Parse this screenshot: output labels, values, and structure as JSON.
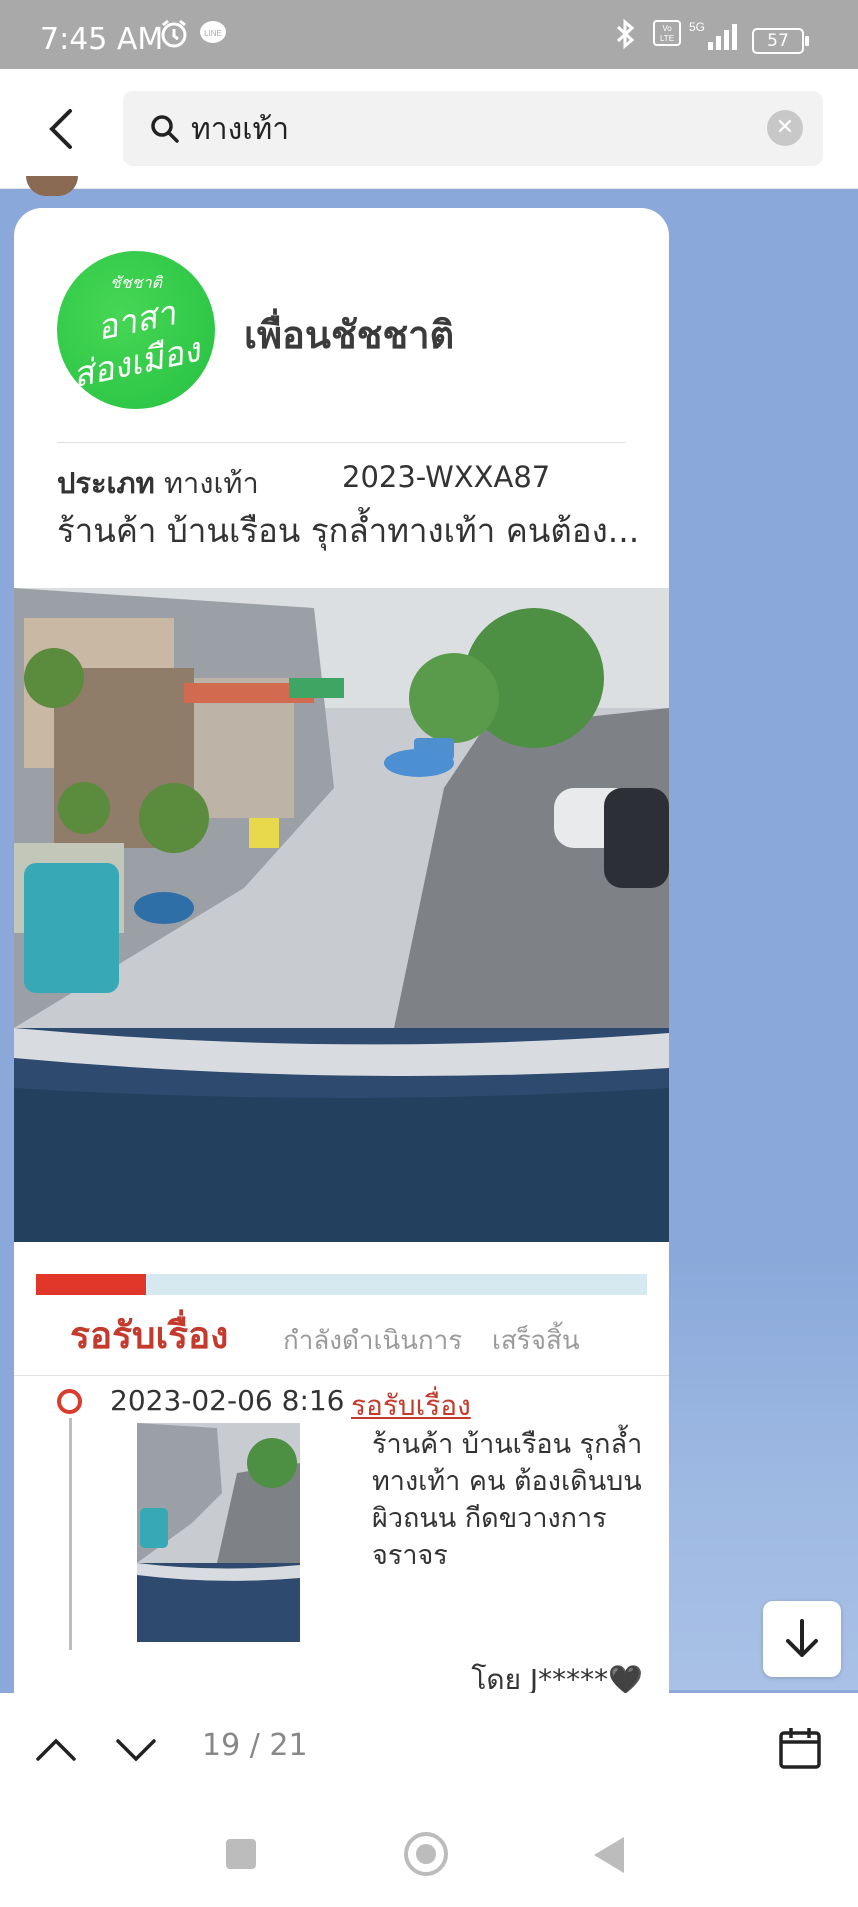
{
  "status_bar": {
    "time": "7:45 AM",
    "icons": [
      "alarm-icon",
      "line-notification-icon",
      "bluetooth-icon",
      "volte-icon",
      "5g-signal-icon"
    ],
    "battery": "57"
  },
  "search": {
    "query": "ทางเท้า",
    "icons": [
      "back-icon",
      "search-icon",
      "clear-icon"
    ]
  },
  "card": {
    "logo_lines": [
      "ชัชชาติ",
      "อาสา",
      "ส่องเมือง"
    ],
    "org_name": "เพื่อนชัชชาติ",
    "type_label": "ประเภท",
    "type_value": "ทางเท้า",
    "case_id": "2023-WXXA87",
    "description": "ร้านค้า บ้านเรือน รุกล้ำทางเท้า คนต้อง...",
    "photo": "street-photo",
    "progress": 0.18,
    "status_tabs": [
      {
        "label": "รอรับเรื่อง",
        "active": true
      },
      {
        "label": "กำลังดำเนินการ",
        "active": false
      },
      {
        "label": "เสร็จสิ้น",
        "active": false
      }
    ],
    "timeline": {
      "datetime": "2023-02-06 8:16",
      "status": "รอรับเรื่อง",
      "text": "ร้านค้า บ้านเรือน รุกล้ำทางเท้า คน ต้องเดินบนผิวถนน กีดขวางการจราจร",
      "by": "โดย J*****🖤"
    }
  },
  "bottom": {
    "page_count": "19 / 21",
    "icons": [
      "chevron-up-icon",
      "chevron-down-icon",
      "calendar-icon"
    ]
  },
  "colors": {
    "accent": "#c43a2c",
    "progress_fill": "#e0372a",
    "progress_track": "#d6e9f0",
    "chat_bg": "#8aa9da",
    "logo_green": "#2cc646"
  }
}
